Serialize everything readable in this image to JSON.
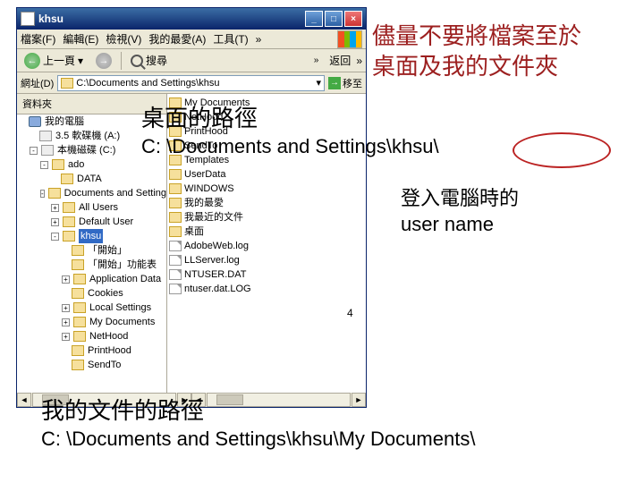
{
  "title": "khsu",
  "menu": {
    "file": "檔案(F)",
    "edit": "編輯(E)",
    "view": "檢視(V)",
    "fav": "我的最愛(A)",
    "tools": "工具(T)",
    "more": "»"
  },
  "toolbar": {
    "back": "上一頁",
    "search": "搜尋",
    "more": "»",
    "backBtn": "返回"
  },
  "address": {
    "label": "網址(D)",
    "value": "C:\\Documents and Settings\\khsu",
    "go": "移至"
  },
  "sidebar": {
    "header": "資料夾"
  },
  "tree": [
    {
      "ind": 0,
      "pm": "",
      "icon": "c",
      "label": "我的電腦"
    },
    {
      "ind": 1,
      "pm": "",
      "icon": "d",
      "label": "3.5 軟碟機 (A:)"
    },
    {
      "ind": 1,
      "pm": "-",
      "icon": "d",
      "label": "本機磁碟 (C:)"
    },
    {
      "ind": 2,
      "pm": "-",
      "icon": "f",
      "label": "ado"
    },
    {
      "ind": 3,
      "pm": "",
      "icon": "f",
      "label": "DATA"
    },
    {
      "ind": 2,
      "pm": "-",
      "icon": "f",
      "label": "Documents and Settings"
    },
    {
      "ind": 3,
      "pm": "+",
      "icon": "f",
      "label": "All Users"
    },
    {
      "ind": 3,
      "pm": "+",
      "icon": "f",
      "label": "Default User"
    },
    {
      "ind": 3,
      "pm": "-",
      "icon": "f",
      "label": "khsu",
      "sel": true
    },
    {
      "ind": 4,
      "pm": "",
      "icon": "f",
      "label": "「開始」"
    },
    {
      "ind": 4,
      "pm": "",
      "icon": "f",
      "label": "「開始」功能表"
    },
    {
      "ind": 4,
      "pm": "+",
      "icon": "f",
      "label": "Application Data"
    },
    {
      "ind": 4,
      "pm": "",
      "icon": "f",
      "label": "Cookies"
    },
    {
      "ind": 4,
      "pm": "+",
      "icon": "f",
      "label": "Local Settings"
    },
    {
      "ind": 4,
      "pm": "+",
      "icon": "f",
      "label": "My Documents"
    },
    {
      "ind": 4,
      "pm": "+",
      "icon": "f",
      "label": "NetHood"
    },
    {
      "ind": 4,
      "pm": "",
      "icon": "f",
      "label": "PrintHood"
    },
    {
      "ind": 4,
      "pm": "",
      "icon": "f",
      "label": "SendTo"
    }
  ],
  "files": [
    {
      "icon": "f",
      "name": "My Documents"
    },
    {
      "icon": "f",
      "name": "NetHood"
    },
    {
      "icon": "f",
      "name": "PrintHood"
    },
    {
      "icon": "f",
      "name": "SendTo"
    },
    {
      "icon": "f",
      "name": "Templates"
    },
    {
      "icon": "f",
      "name": "UserData"
    },
    {
      "icon": "f",
      "name": "WINDOWS"
    },
    {
      "icon": "f",
      "name": "我的最愛"
    },
    {
      "icon": "f",
      "name": "我最近的文件"
    },
    {
      "icon": "f",
      "name": "桌面"
    },
    {
      "icon": "file",
      "name": "AdobeWeb.log"
    },
    {
      "icon": "file",
      "name": "LLServer.log"
    },
    {
      "icon": "file",
      "name": "NTUSER.DAT"
    },
    {
      "icon": "file",
      "name": "ntuser.dat.LOG"
    }
  ],
  "anno": {
    "warn1": "儘量不要將檔案至於",
    "warn2": "桌面及我的文件夾",
    "desk_label": "桌面的路徑",
    "desk_path": "C: \\Documents and Settings\\khsu\\",
    "login1": "登入電腦時的",
    "login2": "user name",
    "docs_label": "我的文件的路徑",
    "docs_path": "C: \\Documents and Settings\\khsu\\My Documents\\",
    "pagenum": "4"
  }
}
